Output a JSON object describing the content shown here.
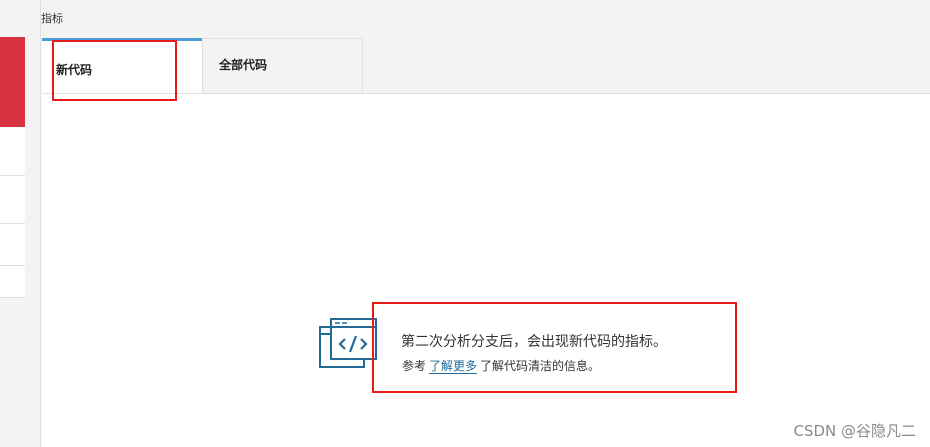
{
  "section": {
    "title": "指标"
  },
  "tabs": [
    {
      "label": "新代码",
      "active": true
    },
    {
      "label": "全部代码",
      "active": false
    }
  ],
  "empty_state": {
    "icon": "code-window-icon",
    "main_text": "第二次分析分支后，会出现新代码的指标。",
    "sub_prefix": "参考",
    "sub_link": "了解更多",
    "sub_suffix": "了解代码清洁的信息。"
  },
  "watermark": "CSDN @谷隐凡二",
  "colors": {
    "accent": "#4b9fd5",
    "sidebar_red": "#d73142",
    "link": "#236a97",
    "highlight": "#e81a1a",
    "icon": "#236a97"
  }
}
